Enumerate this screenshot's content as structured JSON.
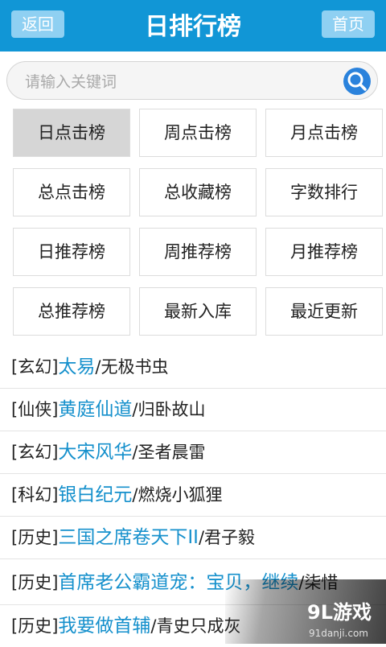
{
  "header": {
    "back_label": "返回",
    "title": "日排行榜",
    "home_label": "首页"
  },
  "search": {
    "placeholder": "请输入关键词",
    "icon": "search-icon"
  },
  "categories": [
    {
      "label": "日点击榜",
      "active": true
    },
    {
      "label": "周点击榜",
      "active": false
    },
    {
      "label": "月点击榜",
      "active": false
    },
    {
      "label": "总点击榜",
      "active": false
    },
    {
      "label": "总收藏榜",
      "active": false
    },
    {
      "label": "字数排行",
      "active": false
    },
    {
      "label": "日推荐榜",
      "active": false
    },
    {
      "label": "周推荐榜",
      "active": false
    },
    {
      "label": "月推荐榜",
      "active": false
    },
    {
      "label": "总推荐榜",
      "active": false
    },
    {
      "label": "最新入库",
      "active": false
    },
    {
      "label": "最近更新",
      "active": false
    }
  ],
  "books": [
    {
      "genre": "[玄幻]",
      "title": "太易",
      "sep": "/",
      "author": "无极书虫"
    },
    {
      "genre": "[仙侠]",
      "title": "黄庭仙道",
      "sep": "/",
      "author": "归卧故山"
    },
    {
      "genre": "[玄幻]",
      "title": "大宋风华",
      "sep": "/",
      "author": "圣者晨雷"
    },
    {
      "genre": "[科幻]",
      "title": "银白纪元",
      "sep": "/",
      "author": "燃烧小狐狸"
    },
    {
      "genre": "[历史]",
      "title": "三国之席卷天下II",
      "sep": "/",
      "author": "君子毅"
    },
    {
      "genre": "[历史]",
      "title": "首席老公霸道宠：宝贝，继续",
      "sep": "/",
      "author": "柒惜"
    },
    {
      "genre": "[历史]",
      "title": "我要做首辅",
      "sep": "/",
      "author": "青史只成灰"
    }
  ],
  "watermark": {
    "text": "9L游戏",
    "url": "91danji.com"
  },
  "colors": {
    "header_bg": "#1196d6",
    "title_link": "#1590cc",
    "active_cell": "#d6d6d6"
  }
}
